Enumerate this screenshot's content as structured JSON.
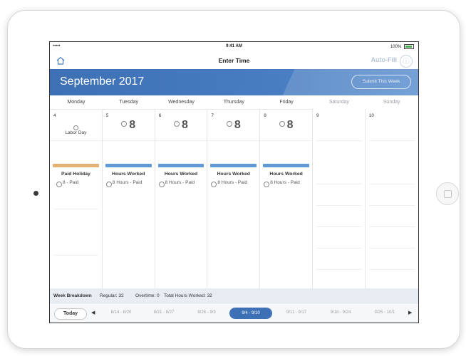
{
  "status_bar": {
    "carrier": "•••••",
    "time": "9:41 AM",
    "battery": "100%"
  },
  "nav": {
    "title": "Enter Time",
    "autofill": "Auto-Fill",
    "info_icon": "ⓘ"
  },
  "banner": {
    "month": "September 2017",
    "submit_label": "Submit This Week"
  },
  "day_headers": [
    "Monday",
    "Tuesday",
    "Wednesday",
    "Thursday",
    "Friday",
    "Saturday",
    "Sunday"
  ],
  "days": [
    {
      "date": "4",
      "hours": "",
      "holiday": "Labor Day",
      "entry_title": "Paid Holiday",
      "entry_detail": "8 - Paid",
      "bar_color": "#e5b074"
    },
    {
      "date": "5",
      "hours": "8",
      "holiday": "",
      "entry_title": "Hours Worked",
      "entry_detail": "8 Hours - Paid",
      "bar_color": "#5f9ad6"
    },
    {
      "date": "6",
      "hours": "8",
      "holiday": "",
      "entry_title": "Hours Worked",
      "entry_detail": "8 Hours - Paid",
      "bar_color": "#5f9ad6"
    },
    {
      "date": "7",
      "hours": "8",
      "holiday": "",
      "entry_title": "Hours Worked",
      "entry_detail": "8 Hours - Paid",
      "bar_color": "#5f9ad6"
    },
    {
      "date": "8",
      "hours": "8",
      "holiday": "",
      "entry_title": "Hours Worked",
      "entry_detail": "8 Hours - Paid",
      "bar_color": "#5f9ad6"
    },
    {
      "date": "9",
      "hours": "",
      "holiday": "",
      "entry_title": "",
      "entry_detail": ""
    },
    {
      "date": "10",
      "hours": "",
      "holiday": "",
      "entry_title": "",
      "entry_detail": ""
    }
  ],
  "breakdown": {
    "label": "Week Breakdown",
    "regular": "Regular: 32",
    "overtime": "Overtime: 0",
    "total": "Total Hours Worked: 32"
  },
  "footer": {
    "today_label": "Today",
    "weeks": [
      "8/14 - 8/20",
      "8/21 - 8/27",
      "8/28 - 9/3",
      "9/4 - 9/10",
      "9/11 - 9/17",
      "9/18 - 9/24",
      "9/25 - 10/1"
    ],
    "active_week": "9/4 - 9/10",
    "prev_arrow": "◀",
    "next_arrow": "▶"
  },
  "colors": {
    "accent": "#3d70b4",
    "holiday_bar": "#e5b074",
    "work_bar": "#5f9ad6"
  }
}
